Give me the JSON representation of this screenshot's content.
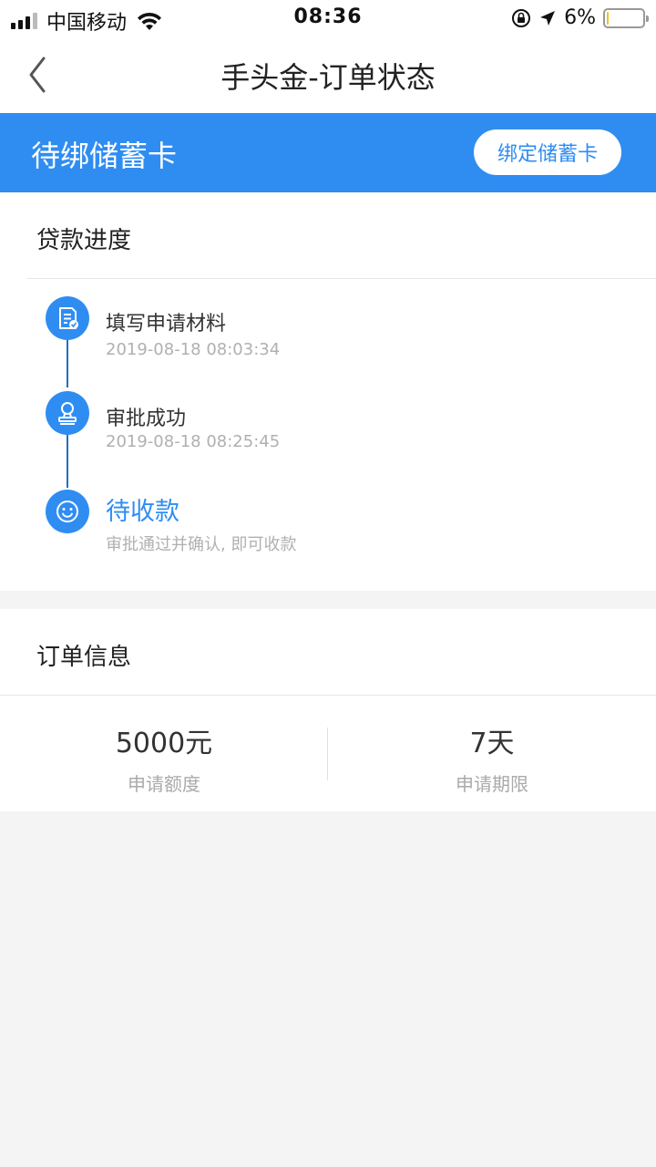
{
  "status_bar": {
    "carrier": "中国移动",
    "time": "08:36",
    "battery_percent": "6%",
    "battery_level": 0.06,
    "icons": [
      "signal-icon",
      "wifi-icon",
      "rotation-lock-icon",
      "location-arrow-icon",
      "battery-icon"
    ]
  },
  "nav": {
    "title": "手头金-订单状态",
    "back_icon": "chevron-left-icon"
  },
  "banner": {
    "title": "待绑储蓄卡",
    "button_label": "绑定储蓄卡",
    "color": "#2f8df2"
  },
  "progress": {
    "section_title": "贷款进度",
    "steps": [
      {
        "icon": "document-check-icon",
        "title": "填写申请材料",
        "subtitle": "2019-08-18 08:03:34",
        "active": false
      },
      {
        "icon": "stamp-icon",
        "title": "审批成功",
        "subtitle": "2019-08-18 08:25:45",
        "active": false
      },
      {
        "icon": "smile-icon",
        "title": "待收款",
        "subtitle": "审批通过并确认, 即可收款",
        "active": true
      }
    ]
  },
  "order": {
    "section_title": "订单信息",
    "stats": [
      {
        "value": "5000元",
        "label": "申请额度"
      },
      {
        "value": "7天",
        "label": "申请期限"
      }
    ]
  }
}
